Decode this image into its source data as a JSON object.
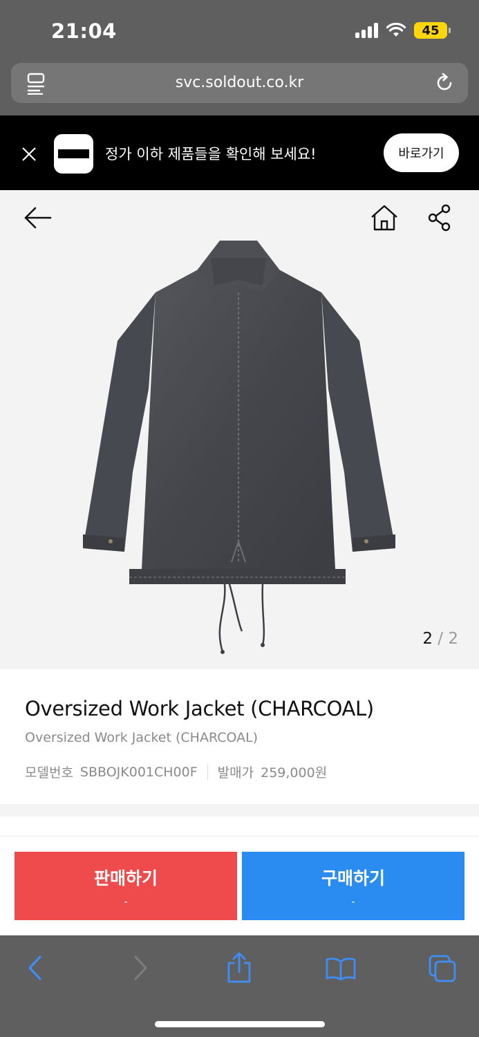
{
  "status_bar": {
    "time": "21:04",
    "battery": "45"
  },
  "browser": {
    "url": "svc.soldout.co.kr"
  },
  "banner": {
    "message": "정가 이하 제품들을 확인해 보세요!",
    "button": "바로가기"
  },
  "gallery": {
    "current": "2",
    "separator": "/",
    "total": "2"
  },
  "product": {
    "title": "Oversized Work Jacket (CHARCOAL)",
    "subtitle": "Oversized Work Jacket (CHARCOAL)",
    "model_label": "모델번호",
    "model_value": "SBBOJK001CH00F",
    "price_label": "발매가",
    "price_value": "259,000원"
  },
  "actions": {
    "sell": {
      "label": "판매하기",
      "sub": "-"
    },
    "buy": {
      "label": "구매하기",
      "sub": "-"
    }
  },
  "colors": {
    "sell": "#ef4b4c",
    "buy": "#2a8cf0",
    "banner_bg": "#000000"
  },
  "icons": [
    "reader-icon",
    "reload-icon",
    "close-icon",
    "back-arrow-icon",
    "home-icon",
    "share-icon",
    "back-icon",
    "forward-icon",
    "share-sheet-icon",
    "bookmarks-icon",
    "tabs-icon"
  ]
}
